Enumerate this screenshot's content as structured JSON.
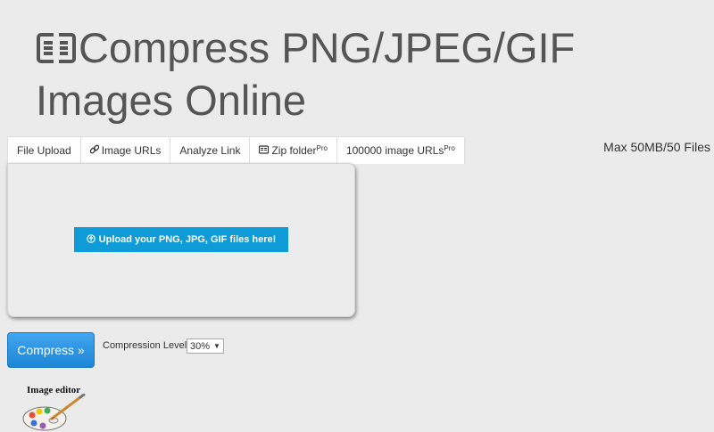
{
  "header": {
    "title_line1": "Compress PNG/JPEG/GIF",
    "title_line2": "Images Online",
    "title_icon": "compress-icon"
  },
  "tabs": [
    {
      "label": "File Upload",
      "icon": null,
      "badge": null
    },
    {
      "label": "Image URLs",
      "icon": "link-icon",
      "badge": null
    },
    {
      "label": "Analyze Link",
      "icon": null,
      "badge": null
    },
    {
      "label": "Zip folder",
      "icon": "zip-icon",
      "badge": "Pro"
    },
    {
      "label": "100000 image URLs",
      "icon": null,
      "badge": "Pro"
    }
  ],
  "limits": {
    "text": "Max 50MB/50 Files"
  },
  "upload": {
    "button_label": "Upload your PNG, JPG, GIF files here!",
    "button_icon": "upload-circle-icon",
    "accent": "#0f9ad8"
  },
  "actions": {
    "compress_label": "Compress »",
    "level_label": "Compression Level:",
    "level_value": "30%"
  },
  "editor": {
    "label": "Image editor",
    "icon": "palette-icon"
  }
}
